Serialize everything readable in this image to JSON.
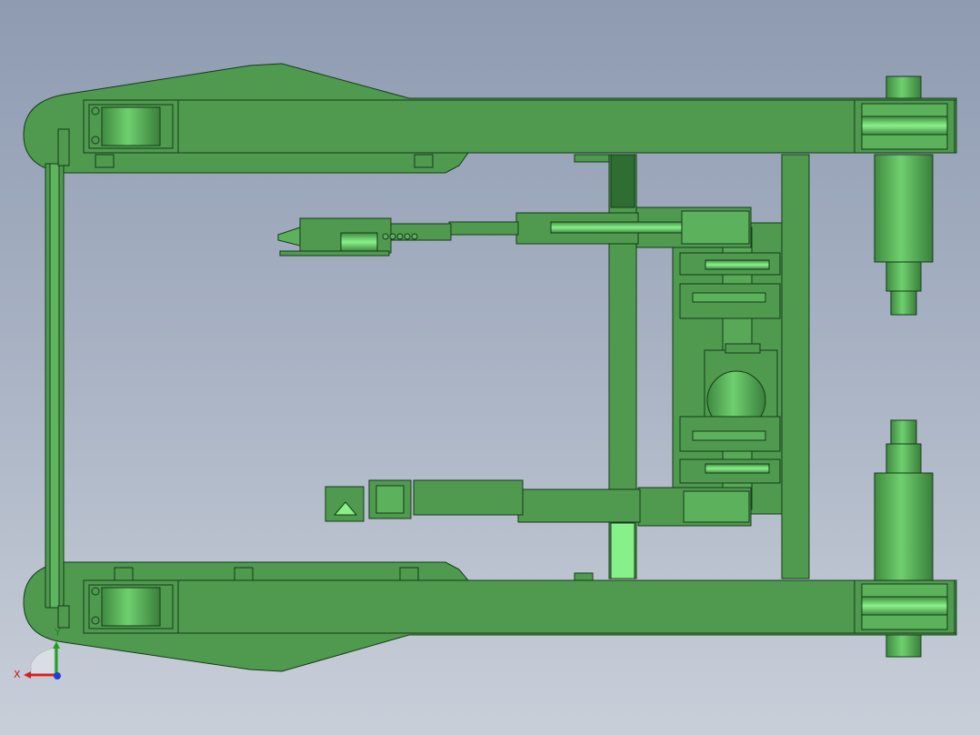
{
  "viewport": {
    "background_top": "#8e9bb1",
    "background_bottom": "#c9cfd9"
  },
  "model": {
    "color_body": "#4f9a4f",
    "color_body_light": "#66c266",
    "color_dark": "#2f6e33",
    "color_outline": "#163a18",
    "color_highlight": "#8ef58e"
  },
  "triad": {
    "x_label": "X",
    "y_label": "Y",
    "x_color": "#d62020",
    "y_color": "#1aa31a",
    "z_color": "#2040d0"
  }
}
